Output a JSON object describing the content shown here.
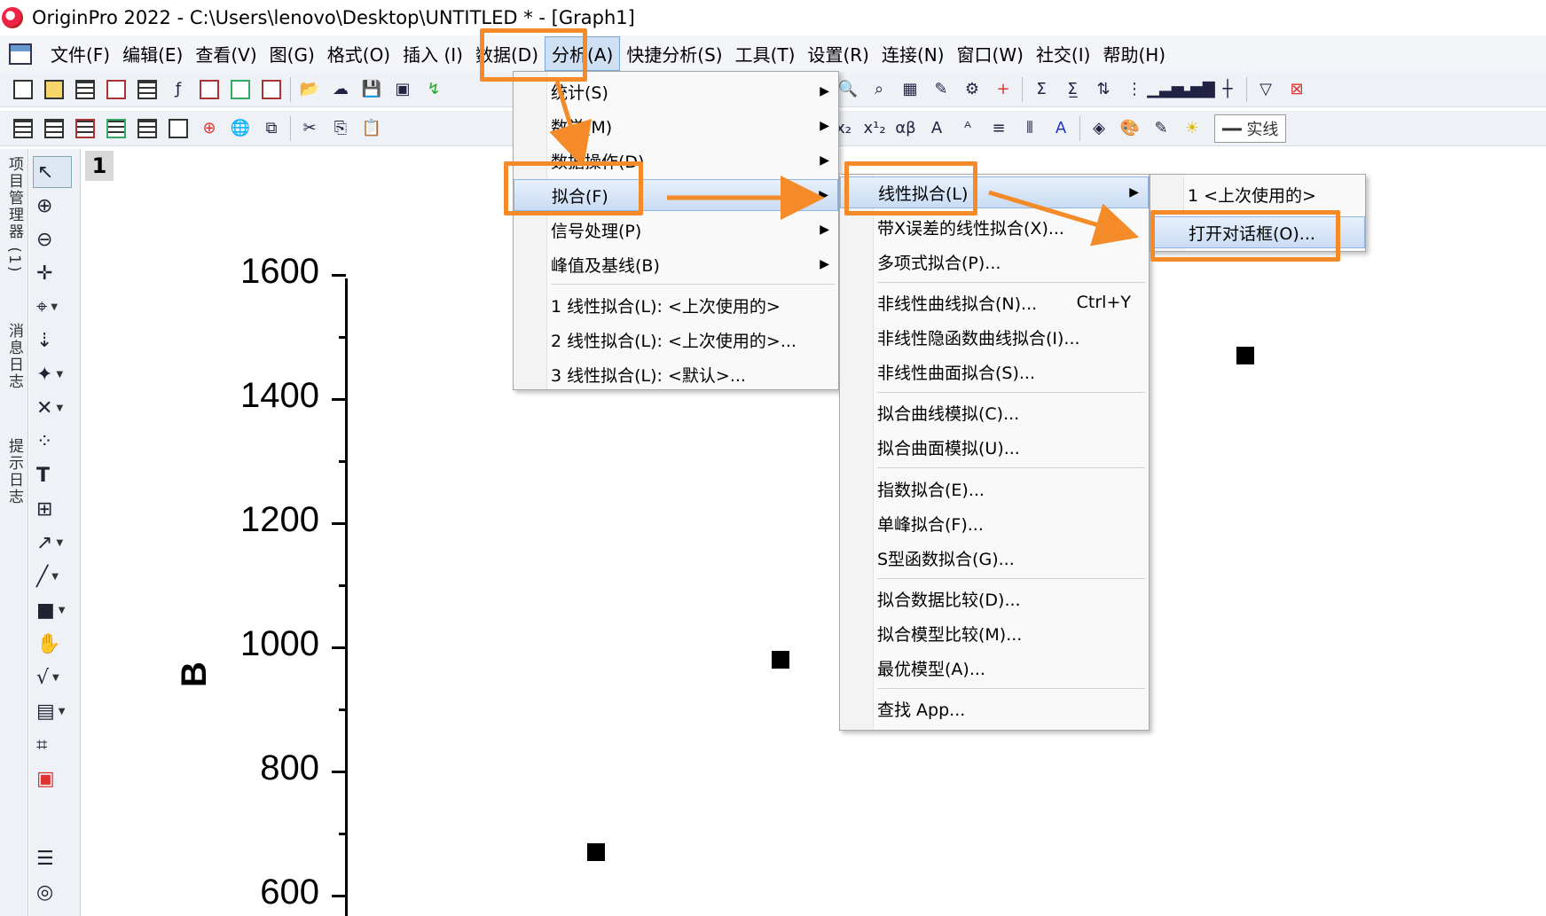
{
  "window": {
    "title": "OriginPro 2022 - C:\\Users\\lenovo\\Desktop\\UNTITLED * - [Graph1]"
  },
  "menubar": {
    "items": [
      "文件(F)",
      "编辑(E)",
      "查看(V)",
      "图(G)",
      "格式(O)",
      "插入 (I)",
      "数据(D)",
      "分析(A)",
      "快捷分析(S)",
      "工具(T)",
      "设置(R)",
      "连接(N)",
      "窗口(W)",
      "社交(I)",
      "帮助(H)"
    ]
  },
  "toolbar": {
    "line_style_label": "实线"
  },
  "left_dock": {
    "tabs": [
      "项目管理器 (1)",
      "消息日志",
      "提示日志"
    ]
  },
  "graph": {
    "page_number": "1",
    "ylabel": "B",
    "yticks": [
      "1600",
      "1400",
      "1200",
      "1000",
      "800",
      "600"
    ],
    "points": [
      {
        "x": "",
        "y": 1470
      },
      {
        "x": "",
        "y": 980
      },
      {
        "x": "",
        "y": 670
      }
    ]
  },
  "analysis_menu": {
    "items": [
      "统计(S)",
      "数学(M)",
      "数据操作(D)",
      "拟合(F)",
      "信号处理(P)",
      "峰值及基线(B)",
      "1 线性拟合(L): <上次使用的>",
      "2 线性拟合(L): <上次使用的>...",
      "3 线性拟合(L): <默认>..."
    ]
  },
  "fit_menu": {
    "items": [
      "线性拟合(L)",
      "带X误差的线性拟合(X)...",
      "多项式拟合(P)...",
      "非线性曲线拟合(N)...",
      "非线性隐函数曲线拟合(I)...",
      "非线性曲面拟合(S)...",
      "拟合曲线模拟(C)...",
      "拟合曲面模拟(U)...",
      "指数拟合(E)...",
      "单峰拟合(F)...",
      "S型函数拟合(G)...",
      "拟合数据比较(D)...",
      "拟合模型比较(M)...",
      "最优模型(A)...",
      "查找 App..."
    ],
    "shortcut": "Ctrl+Y"
  },
  "linear_fit_menu": {
    "items": [
      "1 <上次使用的>",
      "打开对话框(O)..."
    ]
  },
  "accent": {
    "highlight": "#f58a28"
  }
}
